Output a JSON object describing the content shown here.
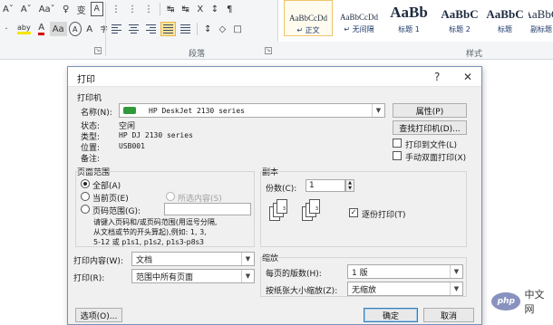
{
  "ribbon": {
    "font_row": [
      "Aˇ",
      "Aˇ",
      "Aaˇ",
      "♀",
      "变",
      "A"
    ],
    "color_row": [
      "·",
      "aby",
      "A",
      "Aa",
      "A",
      "A",
      "字"
    ],
    "para_row1_glyphs": [
      "⋮",
      "⋮",
      "⋮",
      "↹",
      "↹",
      "X",
      "↕",
      "¶"
    ],
    "para_row2_glyphs": [
      "↕",
      "◇",
      "□"
    ],
    "groups": {
      "paragraph_label": "段落",
      "styles_label": "样式"
    },
    "styles": [
      {
        "sample": "AaBbCcDd",
        "name": "↵ 正文"
      },
      {
        "sample": "AaBbCcDd",
        "name": "↵ 无间隔"
      },
      {
        "sample": "AaBb",
        "name": "标题 1"
      },
      {
        "sample": "AaBbC",
        "name": "标题 2"
      },
      {
        "sample": "AaBbC",
        "name": "标题"
      },
      {
        "sample": "AaBbC",
        "name": "副标题"
      }
    ],
    "accent_highlight": "#fde59a"
  },
  "dialog": {
    "title": "打印",
    "help": "?",
    "close": "✕",
    "printer": {
      "section": "打印机",
      "name_label": "名称(N):",
      "name_value": "HP DeskJet 2130 series",
      "properties_button": "属性(P)",
      "find_button": "查找打印机(D)...",
      "status_label": "状态:",
      "status_value": "空闲",
      "type_label": "类型:",
      "type_value": "HP DJ 2130 series",
      "where_label": "位置:",
      "where_value": "USB001",
      "comment_label": "备注:",
      "print_to_file": "打印到文件(L)",
      "manual_duplex": "手动双面打印(X)"
    },
    "page_range": {
      "section": "页面范围",
      "all": "全部(A)",
      "current": "当前页(E)",
      "selection": "所选内容(S)",
      "pages": "页码范围(G):",
      "pages_value": "",
      "hint_line1": "请键入页码和/或页码范围(用逗号分隔,",
      "hint_line2": "从文档或节的开头算起),例如: 1, 3,",
      "hint_line3": "5-12 或 p1s1, p1s2, p1s3-p8s3"
    },
    "print_what_label": "打印内容(W):",
    "print_what_value": "文档",
    "print_label": "打印(R):",
    "print_value": "范围中所有页面",
    "copies": {
      "section": "副本",
      "count_label": "份数(C):",
      "count_value": "1",
      "collate": "逐份打印(T)",
      "page_numbers": [
        "1",
        "2",
        "3",
        "1",
        "2",
        "3"
      ]
    },
    "zoom": {
      "section": "缩放",
      "pages_per_sheet_label": "每页的版数(H):",
      "pages_per_sheet_value": "1 版",
      "scale_label": "按纸张大小缩放(Z):",
      "scale_value": "无缩放"
    },
    "options_button": "选项(O)...",
    "ok_button": "确定",
    "cancel_button": "取消"
  },
  "watermark": {
    "badge": "php",
    "text": "中文网"
  }
}
